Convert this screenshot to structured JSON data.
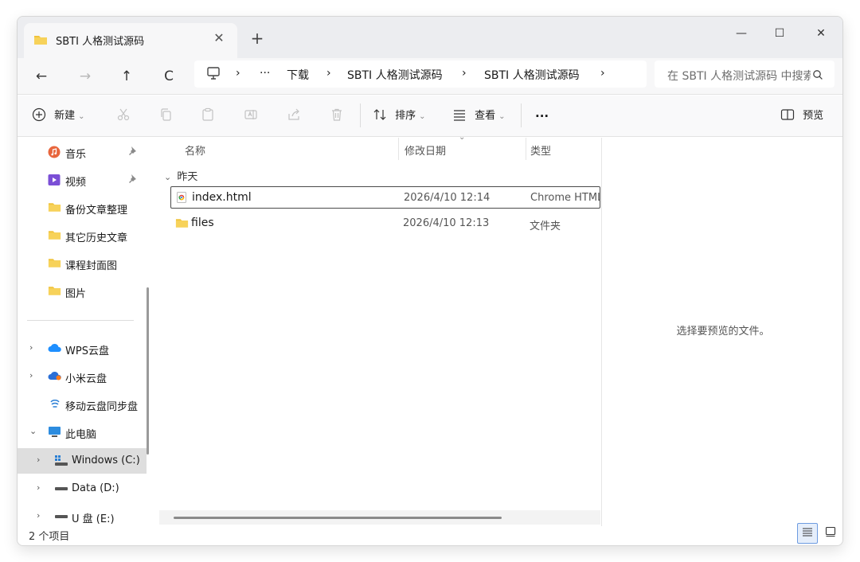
{
  "window": {
    "tab_title": "SBTI 人格测试源码",
    "tab_close": "✕",
    "new_tab": "+",
    "controls": {
      "minimize": "—",
      "maximize": "☐",
      "close": "✕"
    }
  },
  "nav": {
    "back": "←",
    "forward": "→",
    "up": "↑",
    "refresh": "C",
    "breadcrumb": {
      "sep": "›",
      "more": "···",
      "items": [
        "下载",
        "SBTI 人格测试源码",
        "SBTI 人格测试源码"
      ]
    },
    "search_placeholder": "在 SBTI 人格测试源码 中搜索"
  },
  "commands": {
    "new_label": "新建",
    "sort_label": "排序",
    "view_label": "查看",
    "more": "···",
    "preview_label": "预览"
  },
  "sidebar": {
    "quick_access": [
      {
        "label": "音乐",
        "icon": "music-icon",
        "pinned": true
      },
      {
        "label": "视频",
        "icon": "video-icon",
        "pinned": true
      },
      {
        "label": "备份文章整理",
        "icon": "folder-icon"
      },
      {
        "label": "其它历史文章",
        "icon": "folder-icon"
      },
      {
        "label": "课程封面图",
        "icon": "folder-icon"
      },
      {
        "label": "图片",
        "icon": "folder-icon"
      }
    ],
    "locations": [
      {
        "label": "WPS云盘",
        "icon": "wps-cloud-icon"
      },
      {
        "label": "小米云盘",
        "icon": "xiaomi-cloud-icon"
      },
      {
        "label": "移动云盘同步盘",
        "icon": "mobile-cloud-icon"
      },
      {
        "label": "此电脑",
        "icon": "pc-icon"
      },
      {
        "label": "Windows (C:)",
        "icon": "drive-icon",
        "selected": true
      },
      {
        "label": "Data (D:)",
        "icon": "drive-icon"
      },
      {
        "label": "U 盘 (E:)",
        "icon": "drive-icon"
      }
    ],
    "pin_glyph": "📌",
    "expand_glyph": "›",
    "expanded_glyph": "⌄"
  },
  "filelist": {
    "columns": {
      "name": "名称",
      "date": "修改日期",
      "type": "类型"
    },
    "group_label": "昨天",
    "group_chevron": "⌄",
    "sort_chevron": "⌄",
    "rows": [
      {
        "name": "index.html",
        "date": "2026/4/10 12:14",
        "type": "Chrome HTML Document",
        "icon": "chrome-html-icon"
      },
      {
        "name": "files",
        "date": "2026/4/10 12:13",
        "type": "文件夹",
        "icon": "folder-icon"
      }
    ]
  },
  "preview": {
    "message": "选择要预览的文件。"
  },
  "status": {
    "item_count": "2 个项目"
  },
  "colors": {
    "folder": "#f0c33c",
    "accent": "#6d9be0"
  }
}
